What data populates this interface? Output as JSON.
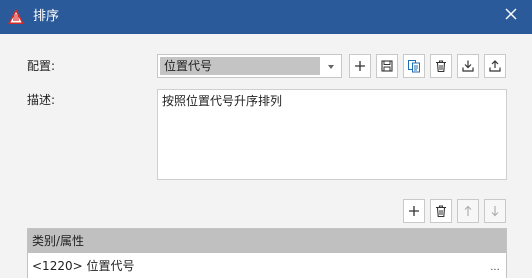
{
  "window": {
    "title": "排序",
    "icons": {
      "app": "warning-triangle-icon",
      "close": "close-icon"
    }
  },
  "config": {
    "label": "配置:",
    "selected": "位置代号"
  },
  "toolbar_icons": [
    "plus-icon",
    "save-icon",
    "copy-icon",
    "delete-icon",
    "download-icon",
    "upload-icon"
  ],
  "description": {
    "label": "描述:",
    "text": "按照位置代号升序排列"
  },
  "list_toolbar_icons": [
    "plus-icon",
    "delete-icon",
    "arrow-up-icon",
    "arrow-down-icon"
  ],
  "grid": {
    "header": "类别/属性",
    "rows": [
      {
        "value": "<1220> 位置代号",
        "action": "..."
      }
    ]
  },
  "colors": {
    "titlebar": "#2a5a9a",
    "app_icon": "#d62828"
  }
}
